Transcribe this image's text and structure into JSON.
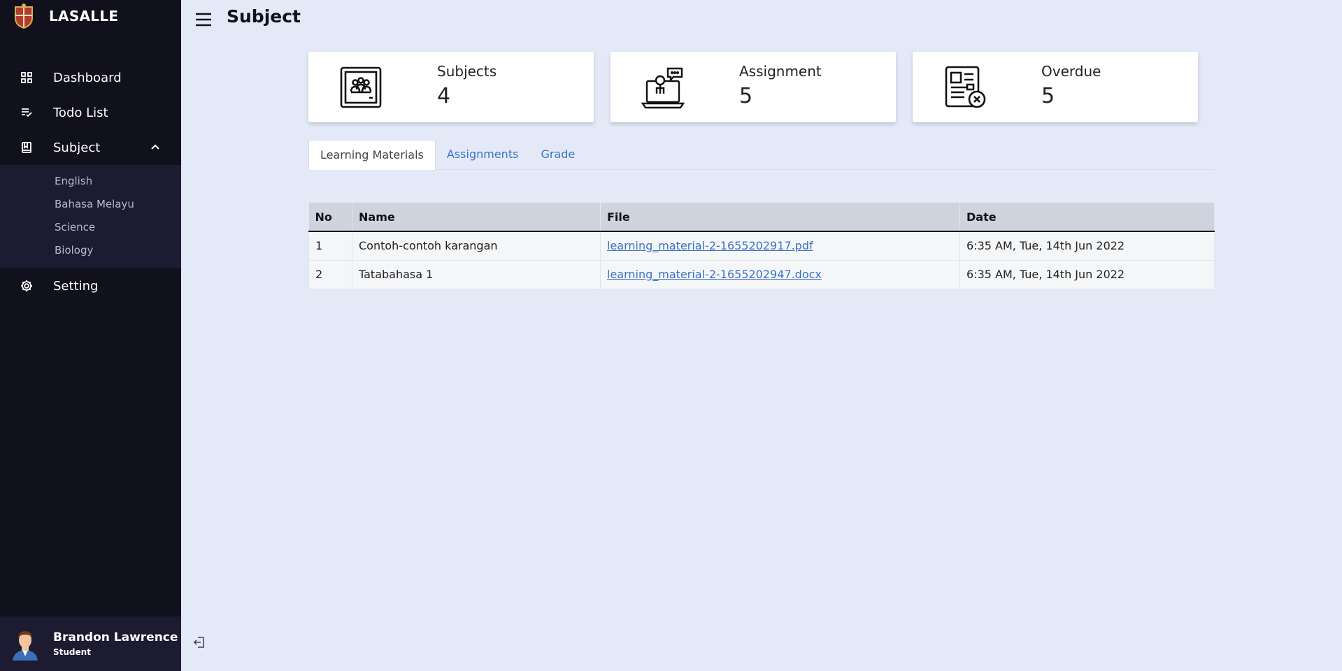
{
  "brand": {
    "name": "LASALLE"
  },
  "sidebar": {
    "items": [
      {
        "label": "Dashboard"
      },
      {
        "label": "Todo List"
      },
      {
        "label": "Subject"
      },
      {
        "label": "Setting"
      }
    ],
    "submenu": [
      "English",
      "Bahasa Melayu",
      "Science",
      "Biology"
    ]
  },
  "profile": {
    "name": "Brandon Lawrence",
    "role": "Student"
  },
  "header": {
    "title": "Subject"
  },
  "cards": [
    {
      "title": "Subjects",
      "value": "4"
    },
    {
      "title": "Assignment",
      "value": "5"
    },
    {
      "title": "Overdue",
      "value": "5"
    }
  ],
  "tabs": [
    {
      "label": "Learning Materials"
    },
    {
      "label": "Assignments"
    },
    {
      "label": "Grade"
    }
  ],
  "table": {
    "headers": [
      "No",
      "Name",
      "File",
      "Date"
    ],
    "rows": [
      {
        "no": "1",
        "name": "Contoh-contoh karangan",
        "file": "learning_material-2-1655202917.pdf",
        "date": "6:35 AM, Tue, 14th Jun 2022"
      },
      {
        "no": "2",
        "name": "Tatabahasa 1",
        "file": "learning_material-2-1655202947.docx",
        "date": "6:35 AM, Tue, 14th Jun 2022"
      }
    ]
  },
  "colors": {
    "sidebar": "#11101d",
    "submenu": "#1d1b31",
    "background": "#e4e9f7",
    "link": "#3b72c8"
  }
}
